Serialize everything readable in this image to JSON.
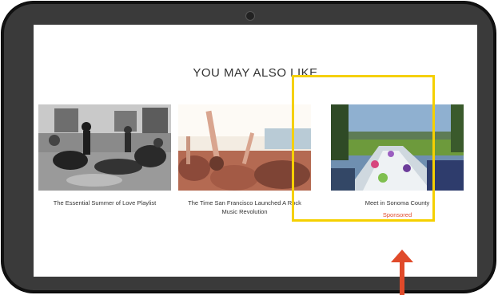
{
  "section": {
    "title": "YOU MAY ALSO LIKE"
  },
  "cards": [
    {
      "caption": "The Essential Summer of Love Playlist"
    },
    {
      "caption": "The Time San Francisco Launched A Rock Music Revolution"
    },
    {
      "caption": "Meet in Sonoma County",
      "badge": "Sponsored"
    }
  ],
  "colors": {
    "highlight": "#f5d000",
    "arrow": "#e04a2a",
    "sponsored": "#e04a2a",
    "device_frame": "#3a3a3a"
  }
}
